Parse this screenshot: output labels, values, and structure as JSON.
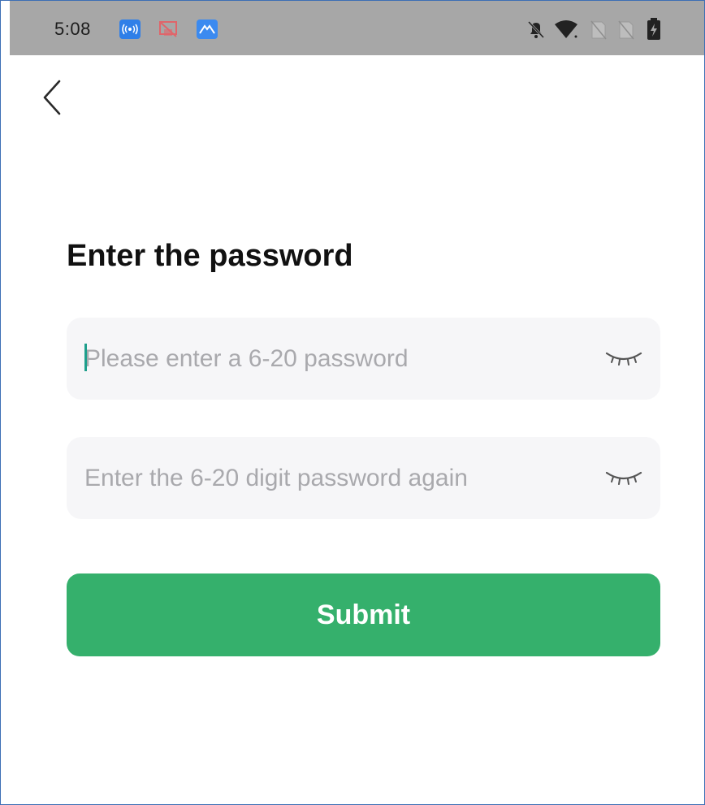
{
  "status_bar": {
    "time": "5:08",
    "left_icons": [
      "radio-broadcast-icon",
      "screen-cast-off-icon",
      "mountain-app-icon"
    ],
    "right_icons": [
      "notifications-muted-icon",
      "wifi-icon",
      "no-sim-icon",
      "no-sim-icon",
      "battery-charging-icon"
    ]
  },
  "header": {
    "back_icon": "chevron-left-icon"
  },
  "form": {
    "title": "Enter the password",
    "password_placeholder": "Please enter a 6-20 password",
    "password_value": "",
    "confirm_placeholder": "Enter the 6-20 digit password again",
    "confirm_value": "",
    "visibility_icon": "eye-closed-icon",
    "submit_label": "Submit"
  },
  "colors": {
    "accent": "#35b06c",
    "status_bar": "#a7a7a7",
    "field_background": "#f6f6f8",
    "caret": "#1f9f8c"
  }
}
